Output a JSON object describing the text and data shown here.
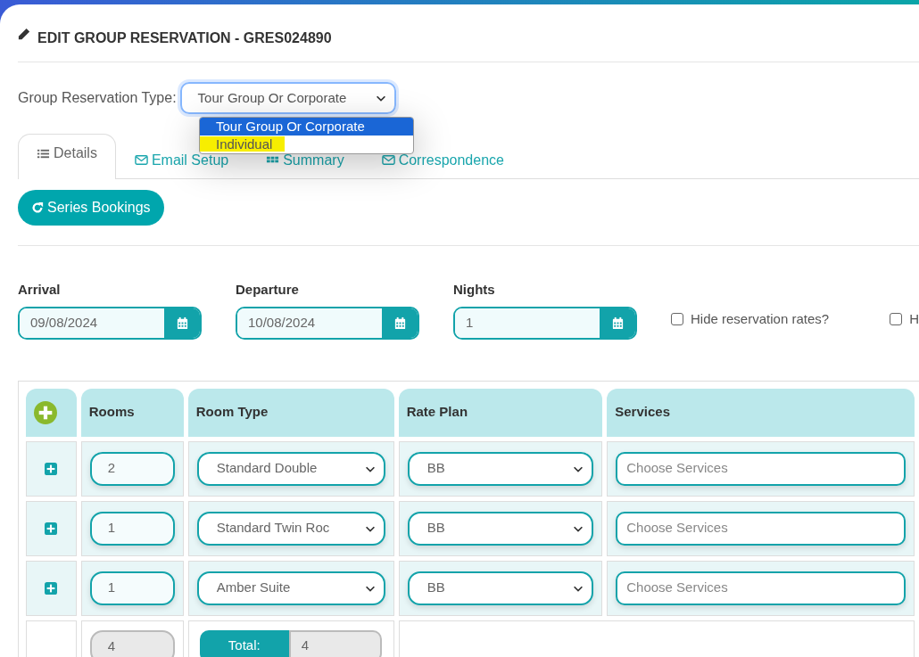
{
  "title": "EDIT GROUP RESERVATION - GRES024890",
  "reservation_type": {
    "label": "Group Reservation Type:",
    "value": "Tour Group Or Corporate",
    "expanded": true,
    "options": [
      {
        "label": "Tour Group Or Corporate",
        "selected": true,
        "highlighted": false
      },
      {
        "label": "Individual",
        "selected": false,
        "highlighted": true
      }
    ]
  },
  "tabs": [
    {
      "label": "Details",
      "kind": "list",
      "selected": true
    },
    {
      "label": "Email Setup",
      "kind": "envelope",
      "selected": false
    },
    {
      "label": "Summary",
      "kind": "grid",
      "selected": false
    },
    {
      "label": "Correspondence",
      "kind": "envelope",
      "selected": false
    }
  ],
  "series_button": "Series Bookings",
  "dates": [
    {
      "label": "Arrival",
      "value": "09/08/2024"
    },
    {
      "label": "Departure",
      "value": "10/08/2024"
    },
    {
      "label": "Nights",
      "value": "1"
    }
  ],
  "checkboxes": [
    {
      "label": "Hide reservation rates?",
      "checked": false
    },
    {
      "label": "H",
      "checked": false
    }
  ],
  "table": {
    "columns": [
      "Rooms",
      "Room Type",
      "Rate Plan",
      "Services"
    ],
    "rows": [
      {
        "rooms": "2",
        "room_type": "Standard Double",
        "rate_plan": "BB",
        "services_placeholder": "Choose Services"
      },
      {
        "rooms": "1",
        "room_type": "Standard Twin Roc",
        "rate_plan": "BB",
        "services_placeholder": "Choose Services"
      },
      {
        "rooms": "1",
        "room_type": "Amber Suite",
        "rate_plan": "BB",
        "services_placeholder": "Choose Services"
      }
    ],
    "footer": {
      "rooms_total": "4",
      "total_label": "Total:",
      "total": "4"
    }
  }
}
